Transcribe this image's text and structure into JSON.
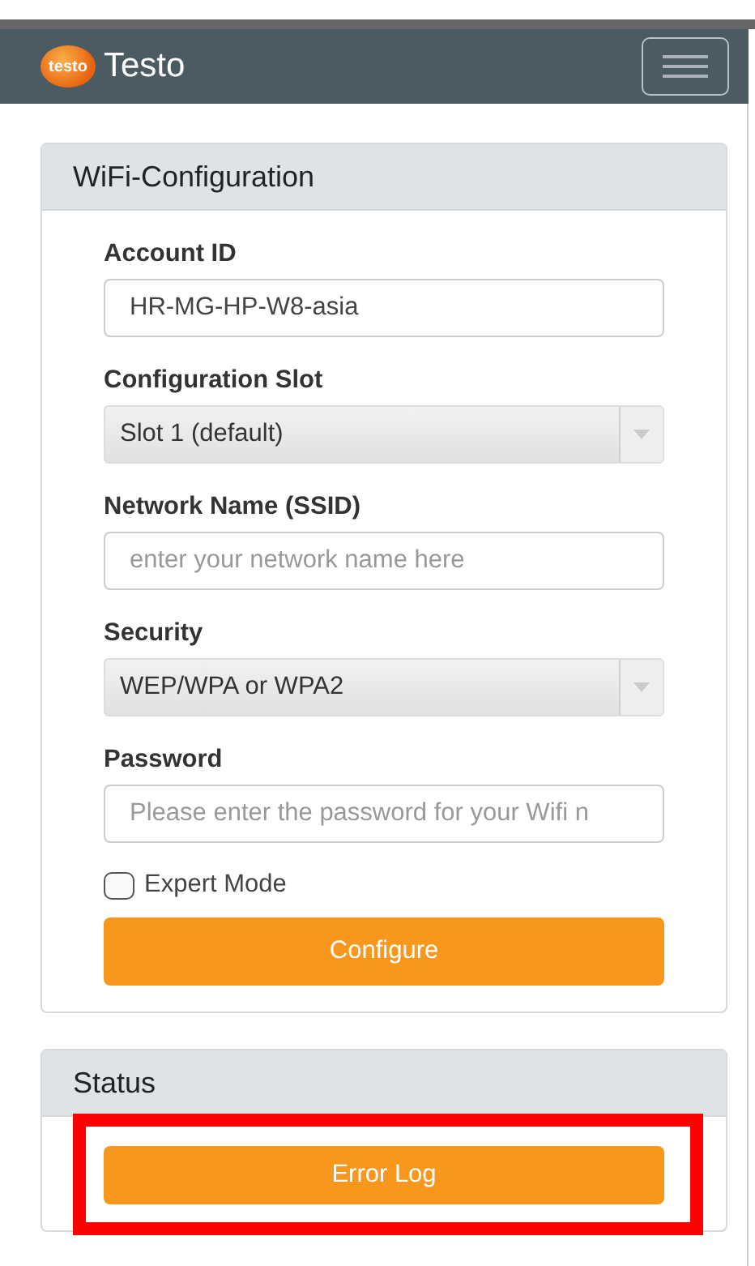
{
  "navbar": {
    "logo_text": "testo",
    "brand": "Testo"
  },
  "wifi_panel": {
    "title": "WiFi-Configuration",
    "fields": [
      {
        "kind": "input",
        "label": "Account ID",
        "value": "HR-MG-HP-W8-asia"
      },
      {
        "kind": "select",
        "label": "Configuration Slot",
        "value": "Slot 1 (default)"
      },
      {
        "kind": "input",
        "label": "Network Name (SSID)",
        "placeholder": "enter your network name here"
      },
      {
        "kind": "select",
        "label": "Security",
        "value": "WEP/WPA or WPA2"
      },
      {
        "kind": "input",
        "label": "Password",
        "placeholder": "Please enter the password for your Wifi n"
      }
    ],
    "expert_mode": {
      "label": "Expert Mode",
      "checked": false
    },
    "button": "Configure"
  },
  "status_panel": {
    "title": "Status",
    "button": "Error Log"
  }
}
